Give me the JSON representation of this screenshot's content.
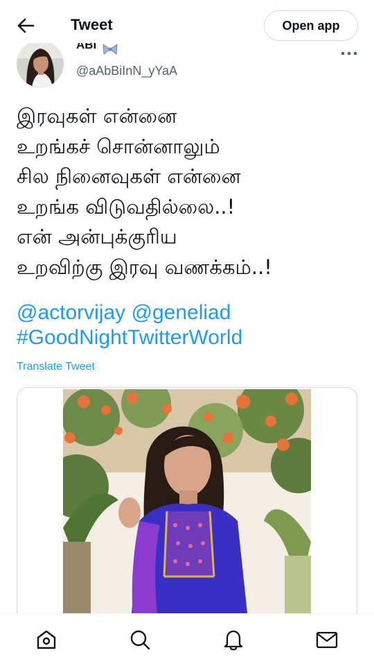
{
  "header": {
    "title": "Tweet",
    "open_app_label": "Open app",
    "back_icon": "arrow-left-icon"
  },
  "author": {
    "display_name": "ABI",
    "handle": "@aAbBiInN_yYaA",
    "name_emoji_icon": "ribbon-bow-icon",
    "more_icon": "more-horizontal-icon"
  },
  "tweet": {
    "lines": [
      "இரவுகள் என்னை",
      "உறங்கச் சொன்னாலும்",
      "சில நினைவுகள் என்னை",
      "உறங்க விடுவதில்லை..!",
      "என் அன்புக்குரிய",
      "உறவிற்கு இரவு வணக்கம்..!"
    ],
    "mention_1": "@actorvijay",
    "mention_2": "@geneliad",
    "hashtag": "#GoodNightTwitterWorld",
    "translate_label": "Translate Tweet"
  },
  "colors": {
    "accent": "#1d9bf0",
    "text": "#0f1419",
    "secondary": "#536471",
    "border": "#cfd9de"
  },
  "bottom_nav": {
    "items": [
      "home-icon",
      "search-icon",
      "notifications-bell-icon",
      "messages-mail-icon"
    ]
  }
}
